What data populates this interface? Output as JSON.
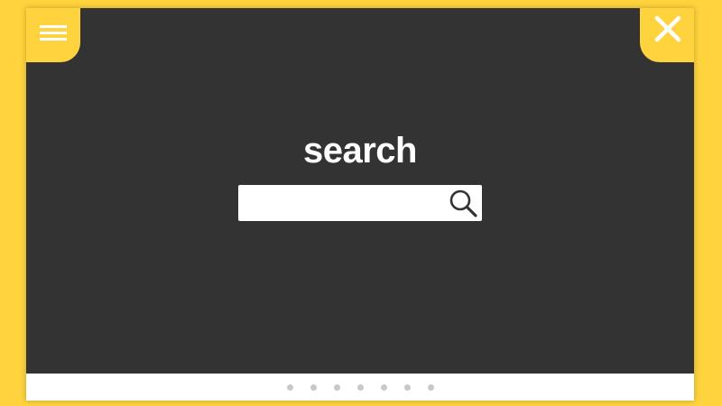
{
  "header": {
    "menu_icon": "hamburger-menu-icon",
    "close_icon": "close-icon"
  },
  "main": {
    "title": "search",
    "search": {
      "value": "",
      "placeholder": "",
      "icon": "magnifier-icon"
    }
  },
  "pagination": {
    "dots": [
      "",
      "",
      "",
      "",
      "",
      "",
      ""
    ]
  },
  "colors": {
    "accent": "#FFD33D",
    "panel": "#333333",
    "footer": "#FFFFFF",
    "dot": "#C8C8C8"
  }
}
